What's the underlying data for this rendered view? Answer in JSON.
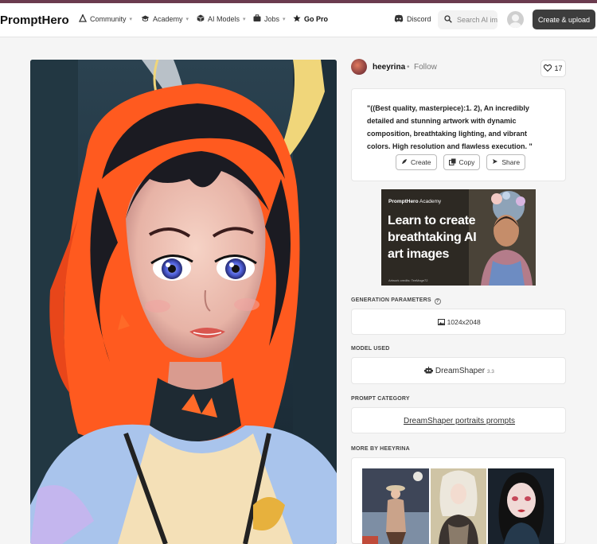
{
  "nav": {
    "logo": "PromptHero",
    "items": [
      {
        "label": "Community",
        "icon": "community-icon",
        "caret": true
      },
      {
        "label": "Academy",
        "icon": "graduation-cap-icon",
        "caret": true
      },
      {
        "label": "AI Models",
        "icon": "cube-icon",
        "caret": true
      },
      {
        "label": "Jobs",
        "icon": "briefcase-icon",
        "caret": true
      },
      {
        "label": "Go Pro",
        "icon": "star-icon",
        "caret": false
      },
      {
        "label": "Discord",
        "icon": "discord-icon",
        "caret": false
      }
    ],
    "search_placeholder": "Search AI images",
    "upload_label": "Create & upload"
  },
  "post": {
    "username": "heeyrina",
    "separator": "•",
    "follow_label": "Follow",
    "likes": "17",
    "prompt": "\"((Best quality, masterpiece):1. 2), An incredibly detailed and stunning artwork with dynamic composition, breathtaking lighting, and vibrant colors. High resolution and flawless execution. \"",
    "actions": {
      "create": "Create",
      "copy": "Copy",
      "share": "Share"
    }
  },
  "ad": {
    "brand_bold": "PromptHero",
    "brand_rest": " Academy",
    "headline": "Learn to create breathtaking AI art images",
    "credit": "Artwork credits: TeeMage72"
  },
  "sections": {
    "generation_parameters": "GENERATION PARAMETERS",
    "info_glyph": "?",
    "dimensions": "1024x2048",
    "model_used": "MODEL USED",
    "model_name": "DreamShaper",
    "model_version": "3.3",
    "prompt_category": "PROMPT CATEGORY",
    "category_link": "DreamShaper portraits prompts",
    "more_by": "MORE BY HEEYRINA"
  },
  "colors": {
    "accent_bar": "#6b3b4f",
    "upload_button": "#3d3d3d",
    "hair_orange": "#ff5a1f",
    "eye_blue": "#4f5fd8"
  }
}
